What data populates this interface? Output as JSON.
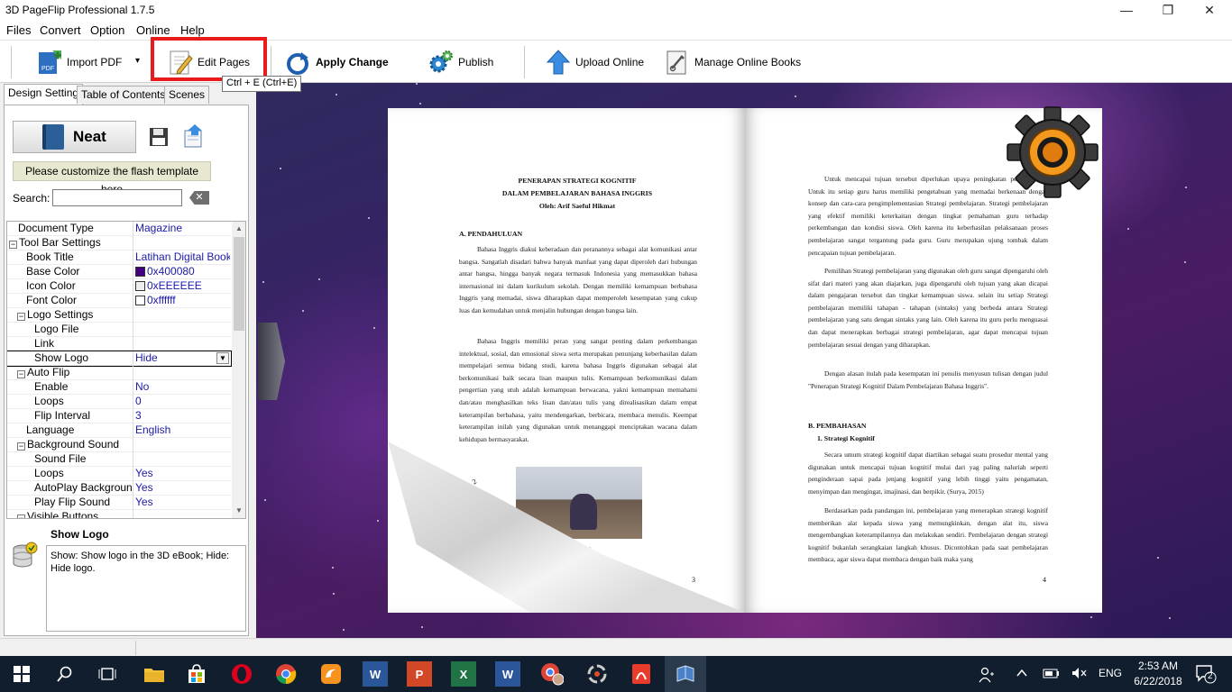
{
  "window": {
    "title": "3D PageFlip Professional 1.7.5",
    "minimize": "—",
    "restore": "❐",
    "close": "✕"
  },
  "menu": [
    "Files",
    "Convert",
    "Option",
    "Online",
    "Help"
  ],
  "toolbar": {
    "import_pdf": "Import PDF",
    "import_dropdown": "▾",
    "edit_pages": "Edit Pages",
    "edit_pages_tooltip": "Ctrl + E (Ctrl+E)",
    "apply_change": "Apply Change",
    "publish": "Publish",
    "upload_online": "Upload Online",
    "manage_online_books": "Manage Online Books"
  },
  "tabs": [
    "Design Setting",
    "Table of Contents",
    "Scenes"
  ],
  "design": {
    "template_name": "Neat",
    "customize_label": "Please customize the flash template here",
    "search_label": "Search:",
    "search_value": "",
    "clear_label": "✕"
  },
  "properties": [
    {
      "key": "Document Type",
      "value": "Magazine",
      "indent": 1
    },
    {
      "key": "Tool Bar Settings",
      "value": "",
      "indent": 0,
      "group": true,
      "expander": "−"
    },
    {
      "key": "Book Title",
      "value": "Latihan Digital Book...",
      "indent": 2
    },
    {
      "key": "Base Color",
      "value": "0x400080",
      "indent": 2,
      "swatch": "#400080"
    },
    {
      "key": "Icon Color",
      "value": "0xEEEEEE",
      "indent": 2,
      "swatch": "#EEEEEE"
    },
    {
      "key": "Font Color",
      "value": "0xffffff",
      "indent": 2,
      "swatch": "#ffffff"
    },
    {
      "key": "Logo Settings",
      "value": "",
      "indent": 1,
      "group": true,
      "expander": "−"
    },
    {
      "key": "Logo File",
      "value": "",
      "indent": 3
    },
    {
      "key": "Link",
      "value": "",
      "indent": 3
    },
    {
      "key": "Show Logo",
      "value": "Hide",
      "indent": 3,
      "selected": true,
      "dropdown": "▼"
    },
    {
      "key": "Auto Flip",
      "value": "",
      "indent": 1,
      "group": true,
      "expander": "−"
    },
    {
      "key": "Enable",
      "value": "No",
      "indent": 3
    },
    {
      "key": "Loops",
      "value": "0",
      "indent": 3
    },
    {
      "key": "Flip Interval",
      "value": "3",
      "indent": 3
    },
    {
      "key": "Language",
      "value": "English",
      "indent": 2
    },
    {
      "key": "Background Sound",
      "value": "",
      "indent": 1,
      "group": true,
      "expander": "−"
    },
    {
      "key": "Sound File",
      "value": "",
      "indent": 3
    },
    {
      "key": "Loops",
      "value": "Yes",
      "indent": 3
    },
    {
      "key": "AutoPlay Backgroun...",
      "value": "Yes",
      "indent": 3
    },
    {
      "key": "Play Flip Sound",
      "value": "Yes",
      "indent": 3
    },
    {
      "key": "Visible Buttons",
      "value": "",
      "indent": 1,
      "group": true,
      "expander": "−"
    }
  ],
  "scroll": {
    "up": "▲",
    "down": "▼"
  },
  "help": {
    "title": "Show Logo",
    "text": "Show: Show logo in the 3D eBook; Hide: Hide logo."
  },
  "book": {
    "left_title_1": "PENERAPAN STRATEGI KOGNITIF",
    "left_title_2": "DALAM PEMBELAJARAN BAHASA INGGRIS",
    "left_author": "Oleh: Arif Saeful Hikmat",
    "section_a": "A.     PENDAHULUAN",
    "para_1": "Bahasa Inggris diakui keberadaan dan peranannya sebagai alat komunikasi antar bangsa. Sangatlah disadari bahwa banyak manfaat yang dapat diperoleh dari hubungan antar bangsa, hingga banyak negara termasuk Indonesia yang memasukkan bahasa internasional ini dalam kurikulum sekolah. Dengan memiliki kemampuan berbahasa Inggris yang memadai, siswa diharapkan dapat memperoleh kesempatan yang cukup luas dan kemudahan untuk menjalin hubungan dengan bangsa lain.",
    "para_2": "Bahasa Inggris memiliki peran yang sangat penting dalam perkembangan intelektual, sosial, dan emosional siswa serta merupakan penunjang keberhasilan dalam mempelajari semua bidang studi, karena bahasa Inggris digunakan sebagai alat berkomunikasi baik secara lisan maupun tulis. Kemampuan berkomunikasi dalam pengertian yang utuh adalah kemampuan berwacana, yakni kemampuan memahami dan/atau menghasilkan teks lisan dan/atau tulis yang direalisasikan dalam empat keterampilan berbahasa, yaitu mendengarkan, berbicara, membaca menulis. Keempat keterampilan inilah yang digunakan untuk menanggapi menciptakan wacana dalam kehidupan bermasyarakat.",
    "left_page_num": "3",
    "curl_num": "2",
    "photo_num": "1",
    "right_para_1": "Untuk mencapai tujuan tersebut diperlukan upaya peningkatan pembelajaran. Untuk itu setiap guru harus memiliki pengetahuan yang memadai berkenaan dengan konsep dan cara-cara pengimplementasian Strategi pembelajaran. Strategi pembelajaran yang efektif memiliki keterkaitan dengan tingkat pemahaman guru terhadap perkembangan dan kondisi siswa. Oleh karena itu keberhasilan pelaksanaan proses pembelajaran sangat tergantung pada guru. Guru merupakan ujung tombak dalam pencapaian tujuan pembelajaran.",
    "right_para_2": "Pemilihan Strategi pembelajaran yang digunakan oleh guru sangat dipengaruhi oleh sifat dari materi yang akan diajarkan, juga dipengaruhi oleh tujuan yang akan dicapai dalam pengajaran tersebut dan tingkat kemampuan siswa. selain itu setiap Strategi pembelajaran memiliki tahapan - tahapan (sintaks) yang berbeda antara Strategi pembelajaran yang satu dengan sintaks yang lain. Oleh karena itu guru perlu menguasai dan dapat menerapkan berbagai strategi pembelajaran, agar dapat mencapai tujuan pembelajaran sesuai dengan yang diharapkan.",
    "right_para_3": "Dengan alasan itulah pada kesempatan ini penulis menyusun tulisan dengan judul \"Penerapan Strategi Kognitif Dalam Pembelajaran Bahasa Inggris\".",
    "section_b": "B.     PEMBAHASAN",
    "section_b1": "1.   Strategi Kognitif",
    "right_para_4": "Secara umum strategi kognitif dapat diartikan sebagai suatu prosedur mental yang digunakan untuk mencapai tujuan kognitif mulai dari yag paling naluriah seperti penginderaan sapai pada jenjang kognitif yang lebih tinggi yaitu pengamatan, menyimpan dan mengingat, imajinasi, dan berpikir. (Surya, 2015)",
    "right_para_5": "Berdasarkan pada pandangan ini, pembelajaran yang menerapkan strategi kognitif memberikan alat kepada siswa yang memungkinkan, dengan alat itu, siswa mengembangkan keterampilannya dan melakukan sendiri. Pembelajaran dengan strategi kognitif bukanlah serangkaian langkah khusus. Dicontohkan pada saat pembelajaran membaca, agar siswa dapat membaca dengan baik maka yang",
    "right_page_num": "4"
  },
  "taskbar": {
    "lang": "ENG",
    "time": "2:53 AM",
    "date": "6/22/2018",
    "notifications": "2",
    "apps": [
      "W",
      "P",
      "X",
      "W"
    ]
  },
  "colors": {
    "highlight": "#e81a1a",
    "accent": "#1a1aa8",
    "taskbar": "#101e2e"
  }
}
